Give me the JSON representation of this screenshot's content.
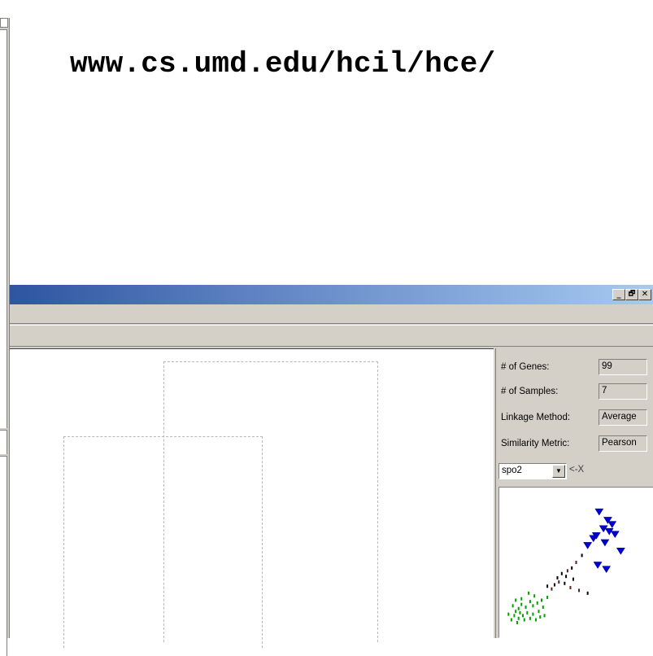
{
  "heading": {
    "url": "www.cs.umd.edu/hcil/hce/"
  },
  "window": {
    "controls": {
      "minimize": "_",
      "restore": "🗗",
      "close": "✕"
    }
  },
  "info": {
    "genes_label": "# of Genes:",
    "genes_value": "99",
    "samples_label": "# of Samples:",
    "samples_value": "7",
    "linkage_label": "Linkage Method:",
    "linkage_value": "Average",
    "similarity_label": "Similarity Metric:",
    "similarity_value": "Pearson",
    "series_selected": "spo2",
    "axis_link": "<-X"
  },
  "chart_data": {
    "type": "scatter",
    "title": "",
    "xlabel": "",
    "ylabel": "",
    "colors": {
      "high": "#0000d0",
      "mid": "#000000",
      "low": "#00a000",
      "outline": "#000080"
    },
    "series": [
      {
        "group": "blue",
        "marker": "triangle-down",
        "points": [
          [
            0.66,
            0.86
          ],
          [
            0.72,
            0.8
          ],
          [
            0.75,
            0.77
          ],
          [
            0.69,
            0.74
          ],
          [
            0.73,
            0.72
          ],
          [
            0.77,
            0.7
          ],
          [
            0.64,
            0.69
          ],
          [
            0.62,
            0.67
          ],
          [
            0.7,
            0.64
          ],
          [
            0.58,
            0.62
          ],
          [
            0.81,
            0.58
          ],
          [
            0.71,
            0.45
          ],
          [
            0.65,
            0.48
          ]
        ]
      },
      {
        "group": "dark",
        "marker": "dash",
        "points": [
          [
            0.5,
            0.5
          ],
          [
            0.54,
            0.55
          ],
          [
            0.47,
            0.46
          ],
          [
            0.44,
            0.44
          ],
          [
            0.43,
            0.4
          ],
          [
            0.4,
            0.42
          ],
          [
            0.38,
            0.36
          ],
          [
            0.37,
            0.39
          ],
          [
            0.35,
            0.34
          ],
          [
            0.33,
            0.31
          ],
          [
            0.42,
            0.35
          ],
          [
            0.48,
            0.38
          ],
          [
            0.52,
            0.3
          ],
          [
            0.58,
            0.28
          ],
          [
            0.3,
            0.33
          ],
          [
            0.46,
            0.32
          ]
        ]
      },
      {
        "group": "green",
        "marker": "dash",
        "points": [
          [
            0.3,
            0.25
          ],
          [
            0.26,
            0.23
          ],
          [
            0.23,
            0.21
          ],
          [
            0.2,
            0.19
          ],
          [
            0.18,
            0.22
          ],
          [
            0.15,
            0.18
          ],
          [
            0.12,
            0.2
          ],
          [
            0.1,
            0.17
          ],
          [
            0.08,
            0.15
          ],
          [
            0.07,
            0.12
          ],
          [
            0.1,
            0.1
          ],
          [
            0.13,
            0.12
          ],
          [
            0.16,
            0.14
          ],
          [
            0.2,
            0.13
          ],
          [
            0.24,
            0.15
          ],
          [
            0.27,
            0.18
          ],
          [
            0.21,
            0.26
          ],
          [
            0.17,
            0.28
          ],
          [
            0.12,
            0.24
          ],
          [
            0.06,
            0.19
          ],
          [
            0.05,
            0.09
          ],
          [
            0.09,
            0.07
          ],
          [
            0.14,
            0.09
          ],
          [
            0.18,
            0.1
          ],
          [
            0.22,
            0.09
          ],
          [
            0.25,
            0.11
          ],
          [
            0.28,
            0.12
          ],
          [
            0.11,
            0.14
          ],
          [
            0.08,
            0.23
          ],
          [
            0.03,
            0.13
          ]
        ]
      }
    ]
  }
}
